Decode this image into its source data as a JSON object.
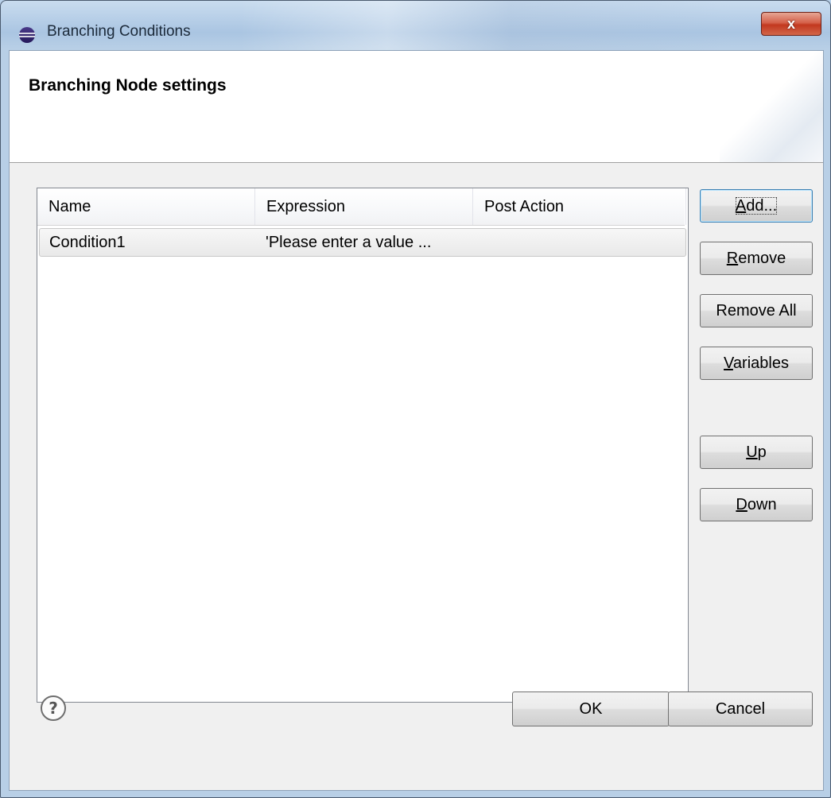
{
  "window": {
    "title": "Branching Conditions",
    "close_label": "x"
  },
  "header": {
    "title": "Branching Node settings"
  },
  "table": {
    "columns": [
      "Name",
      "Expression",
      "Post Action"
    ],
    "rows": [
      {
        "name": "Condition1",
        "expression": "'Please enter a value ...",
        "post_action": ""
      }
    ]
  },
  "side_buttons": {
    "add": {
      "mnemonic": "A",
      "rest": "dd..."
    },
    "remove": {
      "mnemonic": "R",
      "rest": "emove"
    },
    "remove_all": {
      "label": "Remove All"
    },
    "variables": {
      "mnemonic": "V",
      "rest": "ariables"
    },
    "up": {
      "mnemonic": "U",
      "rest": "p"
    },
    "down": {
      "mnemonic": "D",
      "rest": "own"
    }
  },
  "footer": {
    "ok_label": "OK",
    "cancel_label": "Cancel",
    "help_icon": "help-question-icon"
  },
  "colors": {
    "titlebar": "#aac5e2",
    "close_button": "#c2381f",
    "dialog_bg": "#f0f0f0",
    "default_button_border": "#3c7fb1"
  }
}
